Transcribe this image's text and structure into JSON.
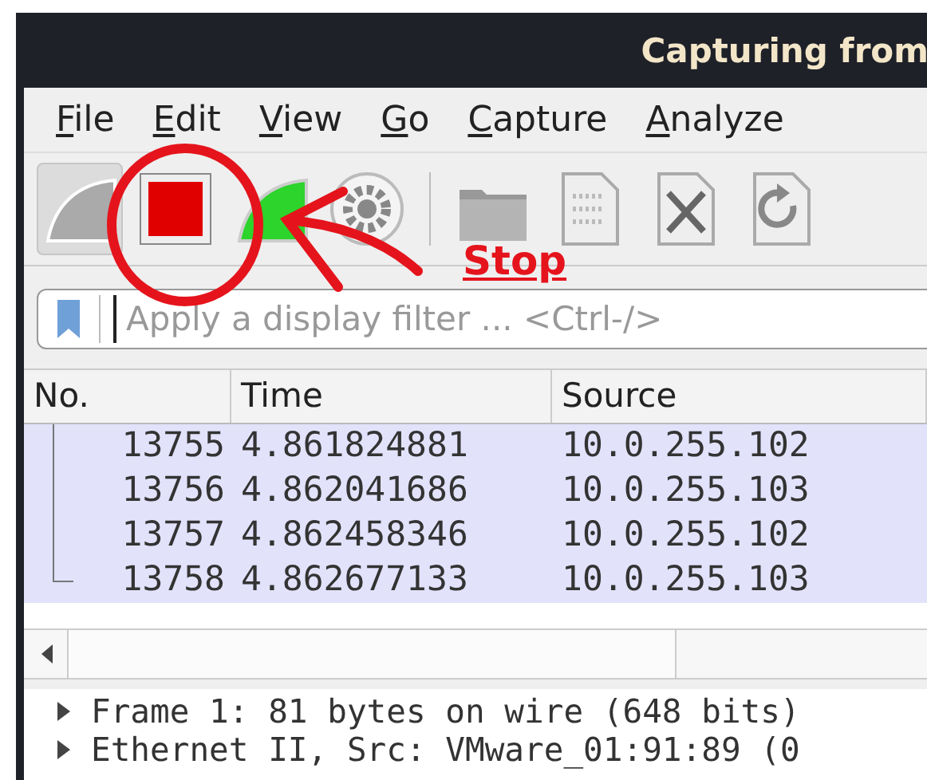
{
  "window": {
    "title": "Capturing from"
  },
  "menu": [
    "File",
    "Edit",
    "View",
    "Go",
    "Capture",
    "Analyze"
  ],
  "toolbar": [
    {
      "kind": "start"
    },
    {
      "kind": "stop"
    },
    {
      "kind": "restart"
    },
    {
      "kind": "options"
    },
    {
      "kind": "separator"
    },
    {
      "kind": "open"
    },
    {
      "kind": "file"
    },
    {
      "kind": "close"
    },
    {
      "kind": "reload"
    }
  ],
  "filter": {
    "placeholder": "Apply a display filter ... <Ctrl-/>"
  },
  "table": {
    "columns": [
      "No.",
      "Time",
      "Source"
    ],
    "rows": [
      [
        "13755",
        "4.861824881",
        "10.0.255.102"
      ],
      [
        "13756",
        "4.862041686",
        "10.0.255.103"
      ],
      [
        "13757",
        "4.862458346",
        "10.0.255.102"
      ],
      [
        "13758",
        "4.862677133",
        "10.0.255.103"
      ]
    ]
  },
  "details": [
    {
      "text": "Frame 1: 81 bytes on wire (648 bits)",
      "expanded": false
    },
    {
      "text": "Ethernet II, Src: VMware_01:91:89 (0",
      "expanded": false
    }
  ],
  "annotation": {
    "label": "Stop"
  }
}
